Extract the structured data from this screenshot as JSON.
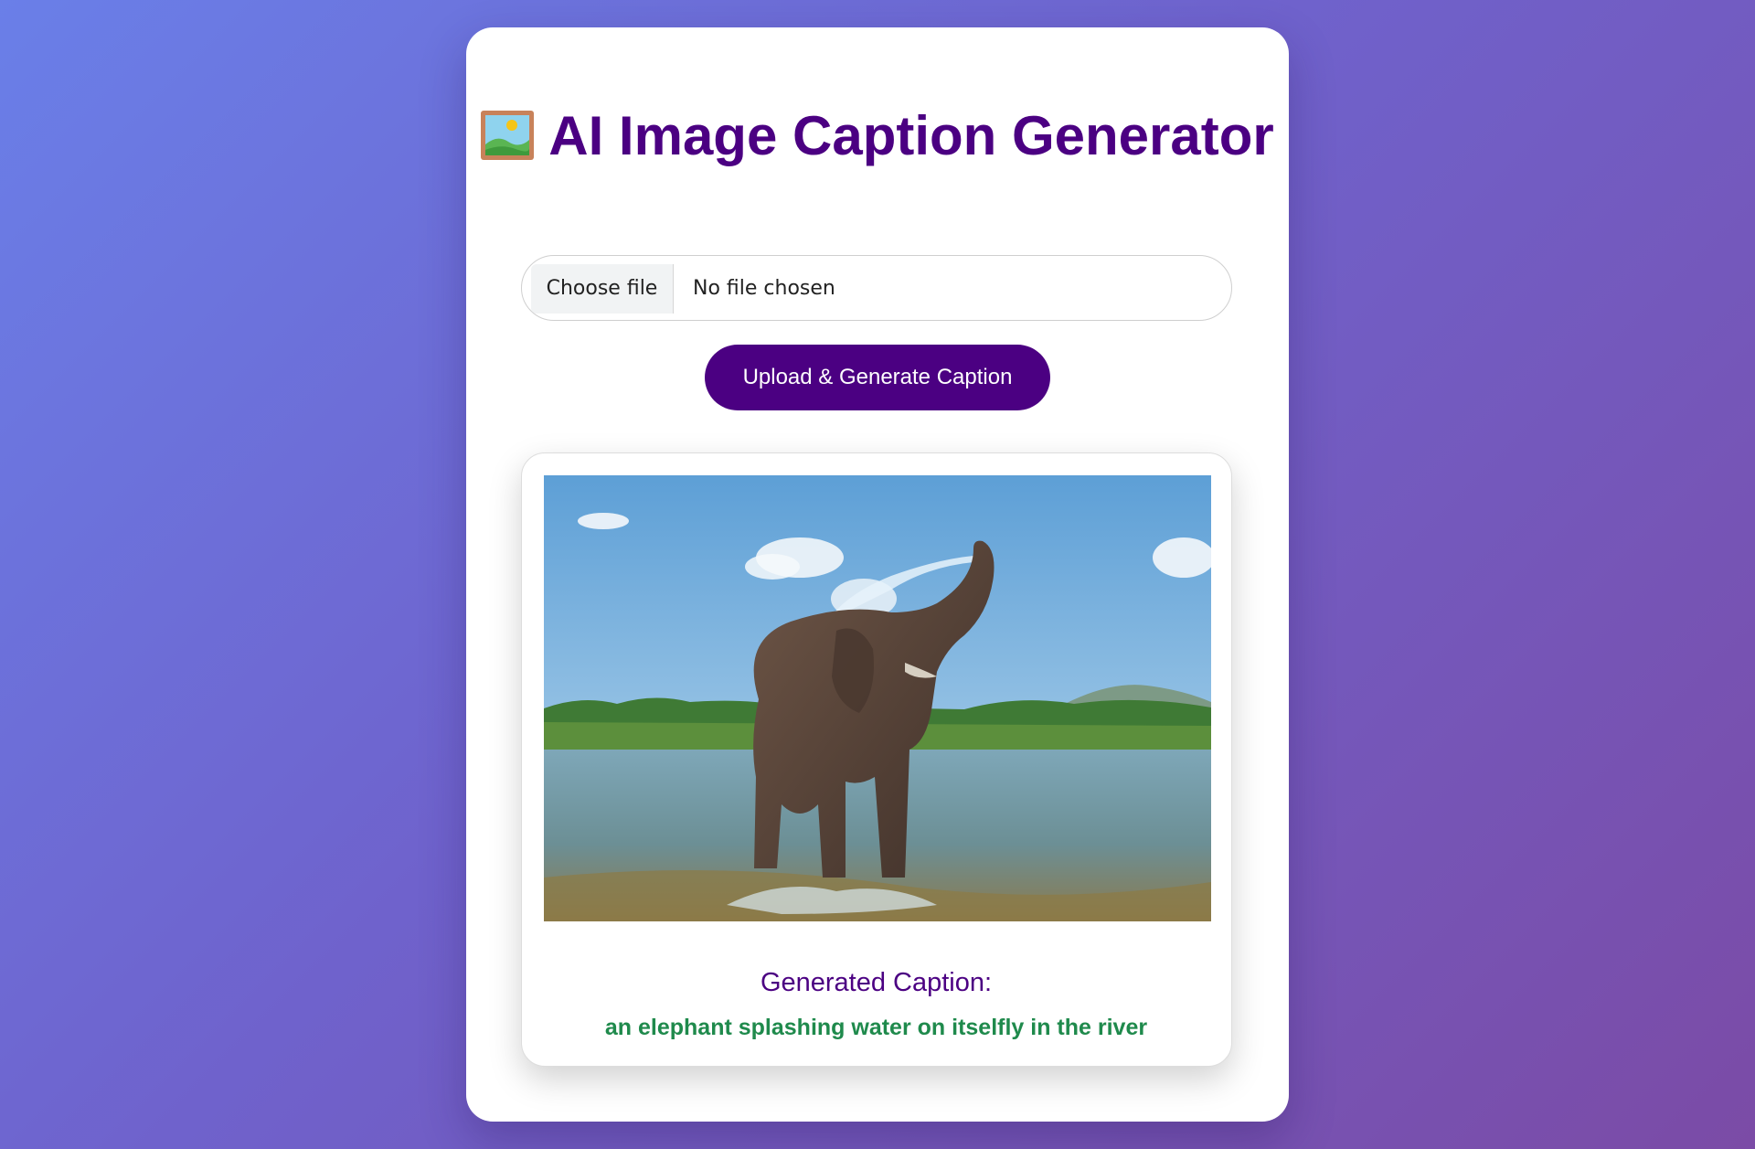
{
  "header": {
    "icon": "framed-picture-icon",
    "title": "AI Image Caption Generator"
  },
  "upload_form": {
    "choose_file_label": "Choose file",
    "file_status": "No file chosen",
    "submit_label": "Upload & Generate Caption"
  },
  "result": {
    "image_icon": "uploaded-elephant-photo",
    "caption_heading": "Generated Caption:",
    "caption_text": "an elephant splashing water on itselfly in the river"
  },
  "colors": {
    "brand": "#4b0082",
    "caption": "#1f8a4c",
    "background_start": "#6a7fe8",
    "background_end": "#7b4ba6"
  }
}
